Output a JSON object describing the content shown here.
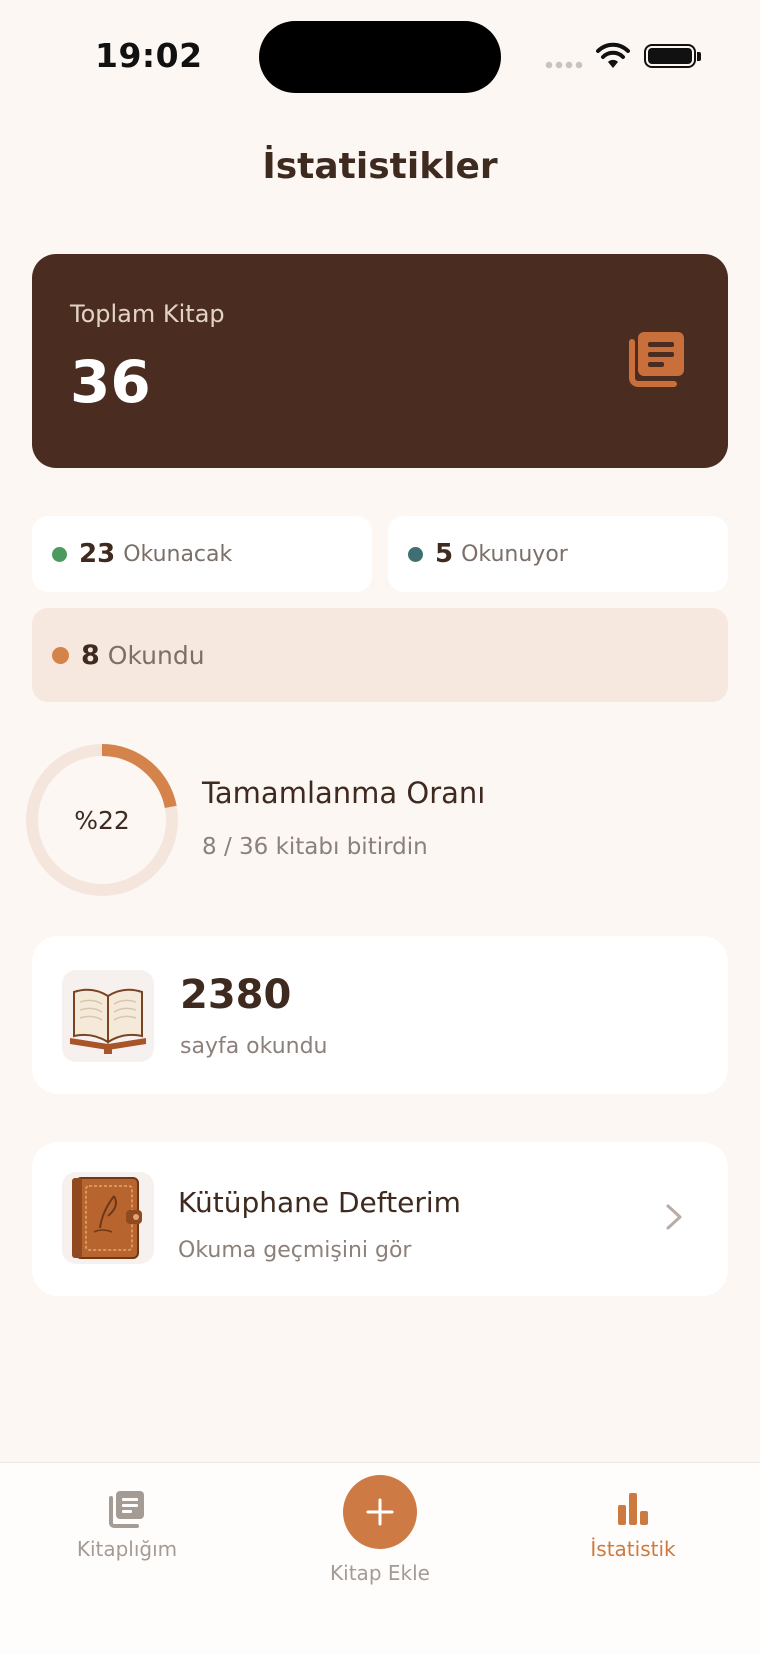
{
  "status_bar": {
    "time": "19:02"
  },
  "header": {
    "title": "İstatistikler"
  },
  "total": {
    "label": "Toplam Kitap",
    "value": "36",
    "icon": "books-stack-icon"
  },
  "stats": [
    {
      "count": "23",
      "label": "Okunacak",
      "color": "#4c9a5e"
    },
    {
      "count": "5",
      "label": "Okunuyor",
      "color": "#3f6f72"
    },
    {
      "count": "8",
      "label": "Okundu",
      "color": "#d4834a"
    }
  ],
  "completion": {
    "percent_label": "%22",
    "fraction": 0.22,
    "title": "Tamamlanma Oranı",
    "subtitle": "8 / 36 kitabı bitirdin",
    "ring_color": "#d4834a",
    "track_color": "#f4e6dd"
  },
  "pages": {
    "value": "2380",
    "label": "sayfa okundu",
    "icon": "open-book-icon"
  },
  "journal": {
    "title": "Kütüphane Defterim",
    "subtitle": "Okuma geçmişini gör",
    "icon": "leather-journal-icon"
  },
  "tabbar": {
    "items": [
      {
        "label": "Kitaplığım",
        "icon": "library-icon",
        "active": false
      },
      {
        "label": "Kitap Ekle",
        "icon": "plus-icon",
        "active": false
      },
      {
        "label": "İstatistik",
        "icon": "bar-chart-icon",
        "active": true
      }
    ]
  },
  "colors": {
    "accent": "#cd7a44",
    "dark_card": "#4a2c20",
    "background": "#fcf7f3"
  }
}
